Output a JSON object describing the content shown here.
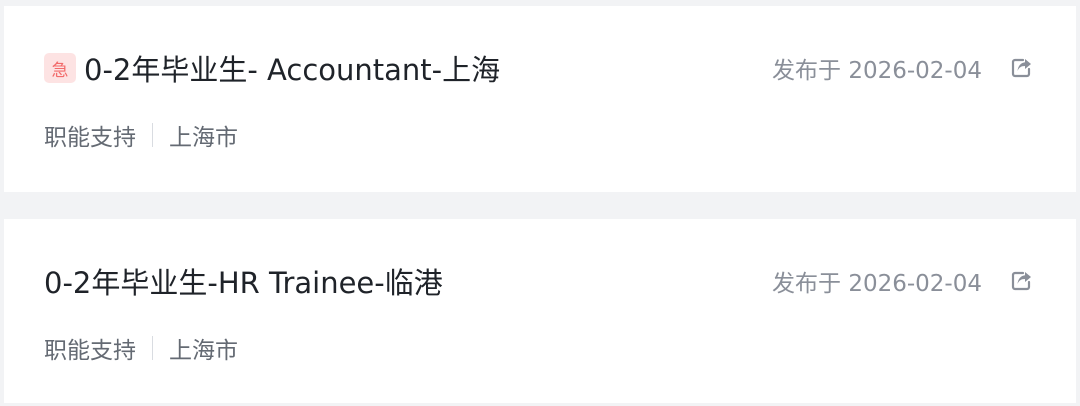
{
  "jobs": [
    {
      "urgent": true,
      "urgent_label": "急",
      "title": "0-2年毕业生- Accountant-上海",
      "publish_text": "发布于 2026-02-04",
      "category": "职能支持",
      "location": "上海市",
      "share_icon": "share-icon"
    },
    {
      "urgent": false,
      "title": "0-2年毕业生-HR Trainee-临港",
      "publish_text": "发布于 2026-02-04",
      "category": "职能支持",
      "location": "上海市",
      "share_icon": "share-icon"
    }
  ],
  "colors": {
    "page_background": "#f2f3f5",
    "card_background": "#ffffff",
    "title_text": "#1f2329",
    "meta_text": "#8a8f99",
    "tag_text": "#646a73",
    "urgent_badge_bg": "#fde3e3",
    "urgent_badge_text": "#f26b6b"
  }
}
